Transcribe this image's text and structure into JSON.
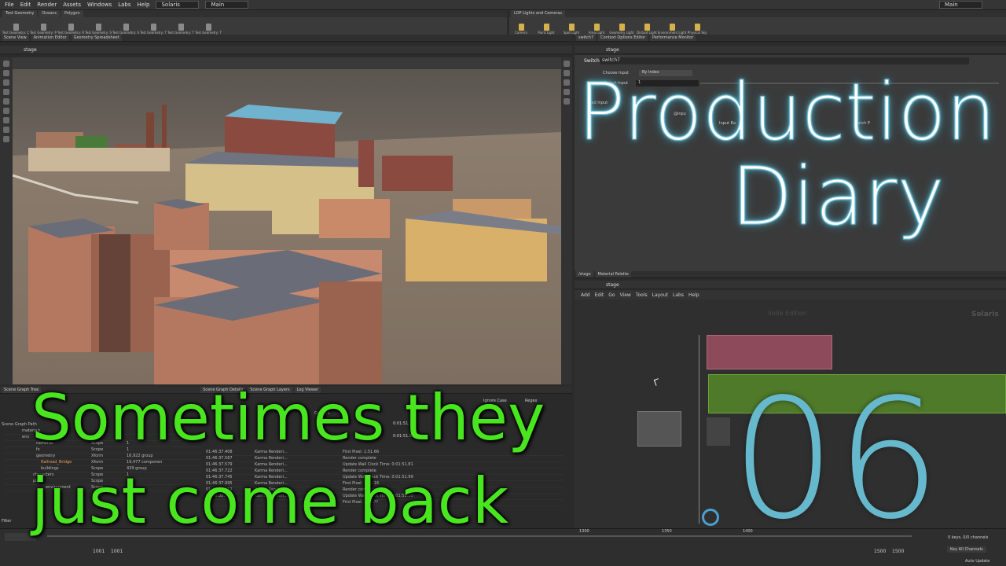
{
  "menu": {
    "items": [
      "File",
      "Edit",
      "Render",
      "Assets",
      "Windows",
      "Labs",
      "Help"
    ],
    "desktop": "Solaris",
    "workspace": "Main",
    "right_desktop": "Main"
  },
  "shelf": {
    "tabs": [
      "Test Geometry",
      "Oceans",
      "Polygon"
    ],
    "tools": [
      "Test Geometry: C",
      "Test Geometry: P",
      "Test Geometry: R",
      "Test Geometry: S",
      "Test Geometry: S",
      "Test Geometry: T",
      "Test Geometry: T",
      "Test Geometry: T"
    ],
    "lop_tab": "LOP Lights and Cameras",
    "lop_tools": [
      "Camera",
      "Point Light",
      "Spot Light",
      "Area Light",
      "Geometry Light",
      "Distant Light",
      "Environment Light",
      "Physical Sky"
    ]
  },
  "viewer": {
    "tabs": [
      "Scene View",
      "Animation Editor",
      "Geometry Spreadsheet"
    ],
    "path": "stage"
  },
  "params": {
    "tabs": [
      "switch7",
      "Context Options Editor",
      "Performance Monitor"
    ],
    "path": "stage",
    "node_type": "Switch",
    "node_name": "switch7",
    "choose_input_label": "Choose Input",
    "choose_input_value": "By Index",
    "select_input_label": "Select Input",
    "select_input_value": "1",
    "bad_input_label": "Bad Input",
    "input_label": "Input Ba",
    "input_name": "@inpu",
    "match_label": "Match P"
  },
  "network": {
    "tabs": [
      "/stage",
      "Material Palette"
    ],
    "path": "stage",
    "menu": [
      "Add",
      "Edit",
      "Go",
      "View",
      "Tools",
      "Layout",
      "Labs",
      "Help"
    ],
    "watermark": "Indie Edition",
    "context_label": "Solaris"
  },
  "scenegraph": {
    "tabs": [
      "Scene Graph Tree",
      "Scene Graph Details",
      "Scene Graph Layers",
      "Log Viewer"
    ],
    "header_path": "Scene Graph Path",
    "rows": [
      {
        "name": "materials",
        "type": "",
        "count": ""
      },
      {
        "name": "env",
        "type": "",
        "count": ""
      },
      {
        "name": "cameras",
        "type": "Scope",
        "count": "1"
      },
      {
        "name": "fx",
        "type": "Scope",
        "count": "1"
      },
      {
        "name": "geometry",
        "type": "Xform",
        "count": "16,922 group"
      },
      {
        "name": "Railroad_Bridge",
        "type": "Xform",
        "count": "19,477 componen"
      },
      {
        "name": "buildings",
        "type": "Scope",
        "count": "439 group"
      },
      {
        "name": "characters",
        "type": "Scope",
        "count": "1"
      },
      {
        "name": "plant",
        "type": "Scope",
        "count": "1"
      },
      {
        "name": "environment",
        "type": "Scope",
        "count": "1"
      }
    ],
    "filter_label": "Filter"
  },
  "log": {
    "ignore_case": "Ignore Case",
    "regex": "Regex",
    "content_header": "Content",
    "rows": [
      {
        "time": "01:46:37.408",
        "source": "Karma Renderi...",
        "msg": "First Pixel: 1:51.66"
      },
      {
        "time": "01:46:37.567",
        "source": "Karma Renderi...",
        "msg": "Render complete"
      },
      {
        "time": "01:46:37.579",
        "source": "Karma Renderi...",
        "msg": "Update Wall Clock Time: 0:01:51.81"
      },
      {
        "time": "01:46:37.722",
        "source": "Karma Renderi...",
        "msg": "Render complete"
      },
      {
        "time": "01:46:37.745",
        "source": "Karma Renderi...",
        "msg": "Update Wall Clock Time: 0:01:51.99"
      },
      {
        "time": "01:46:37.995",
        "source": "Karma Renderi...",
        "msg": "First Pixel: 1:52.16"
      },
      {
        "time": "01:46:38.052",
        "source": "Karma Renderi...",
        "msg": "Render complete"
      },
      {
        "time": "01:46:38.?",
        "source": "Karma Renderi...",
        "msg": "Update Wall Clock Time: 0:01:52.30"
      },
      {
        "time": "",
        "source": "",
        "msg": "First Pixel: 1:52.??"
      }
    ],
    "top_rows": [
      {
        "msg": "0:01:51.35"
      },
      {
        "msg": "0:01:51.51"
      }
    ]
  },
  "timeline": {
    "frame_start": "1001",
    "frame_current": "1001",
    "frame_end": "1500",
    "frame_end2": "1500",
    "ticks": [
      "1300",
      "1350",
      "1400"
    ],
    "keys": "0 keys, 0/0 channels",
    "key_all": "Key All Channels",
    "auto_update": "Auto Update"
  },
  "overlay": {
    "title_line1": "Production",
    "title_line2": "Diary",
    "episode": "06",
    "caption_line1": "Sometimes they",
    "caption_line2": "just come back"
  },
  "colors": {
    "title_blue": "#6fc2d6",
    "caption_green": "#49e61f",
    "node_pink": "#8c4a5a",
    "node_green": "#4f7a2a"
  }
}
